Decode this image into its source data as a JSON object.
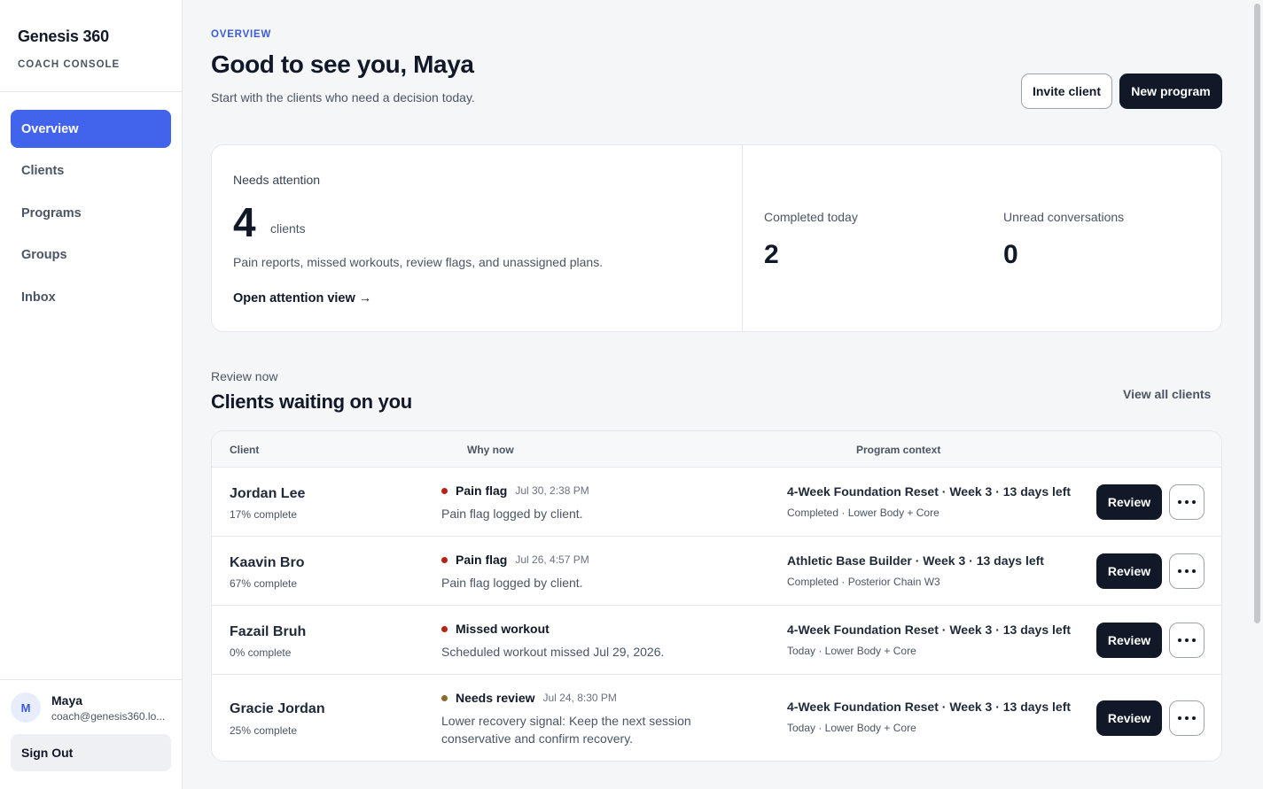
{
  "sidebar": {
    "brand": "Genesis 360",
    "subtitle": "COACH CONSOLE",
    "items": [
      {
        "label": "Overview",
        "active": true
      },
      {
        "label": "Clients",
        "active": false
      },
      {
        "label": "Programs",
        "active": false
      },
      {
        "label": "Groups",
        "active": false
      },
      {
        "label": "Inbox",
        "active": false
      }
    ],
    "user": {
      "initial": "M",
      "name": "Maya",
      "email": "coach@genesis360.lo..."
    },
    "sign_out": "Sign Out"
  },
  "header": {
    "eyebrow": "OVERVIEW",
    "title": "Good to see you, Maya",
    "subtitle": "Start with the clients who need a decision today.",
    "invite_label": "Invite client",
    "new_program_label": "New program"
  },
  "stats": {
    "needs_attention": {
      "label": "Needs attention",
      "value": "4",
      "unit": "clients",
      "description": "Pain reports, missed workouts, review flags, and unassigned plans.",
      "link": "Open attention view →"
    },
    "completed_today": {
      "label": "Completed today",
      "value": "2"
    },
    "unread": {
      "label": "Unread conversations",
      "value": "0"
    }
  },
  "section": {
    "eyebrow": "Review now",
    "title": "Clients waiting on you",
    "view_all": "View all clients"
  },
  "table": {
    "headers": {
      "client": "Client",
      "why": "Why now",
      "context": "Program context"
    },
    "review_label": "Review",
    "rows": [
      {
        "name": "Jordan Lee",
        "progress": "17% complete",
        "why_title": "Pain flag",
        "why_time": "Jul 30, 2:38 PM",
        "why_desc": "Pain flag logged by client.",
        "dot_color": "#b42318",
        "ctx_title": "4-Week Foundation Reset · Week 3 · 13 days left",
        "ctx_sub": "Completed · Lower Body + Core"
      },
      {
        "name": "Kaavin Bro",
        "progress": "67% complete",
        "why_title": "Pain flag",
        "why_time": "Jul 26, 4:57 PM",
        "why_desc": "Pain flag logged by client.",
        "dot_color": "#b42318",
        "ctx_title": "Athletic Base Builder · Week 3 · 13 days left",
        "ctx_sub": "Completed · Posterior Chain W3"
      },
      {
        "name": "Fazail Bruh",
        "progress": "0% complete",
        "why_title": "Missed workout",
        "why_time": "",
        "why_desc": "Scheduled workout missed Jul 29, 2026.",
        "dot_color": "#b42318",
        "ctx_title": "4-Week Foundation Reset · Week 3 · 13 days left",
        "ctx_sub": "Today · Lower Body + Core"
      },
      {
        "name": "Gracie Jordan",
        "progress": "25% complete",
        "why_title": "Needs review",
        "why_time": "Jul 24, 8:30 PM",
        "why_desc": "Lower recovery signal: Keep the next session conservative and confirm recovery.",
        "dot_color": "#8a6a2e",
        "ctx_title": "4-Week Foundation Reset · Week 3 · 13 days left",
        "ctx_sub": "Today · Lower Body + Core"
      }
    ]
  }
}
